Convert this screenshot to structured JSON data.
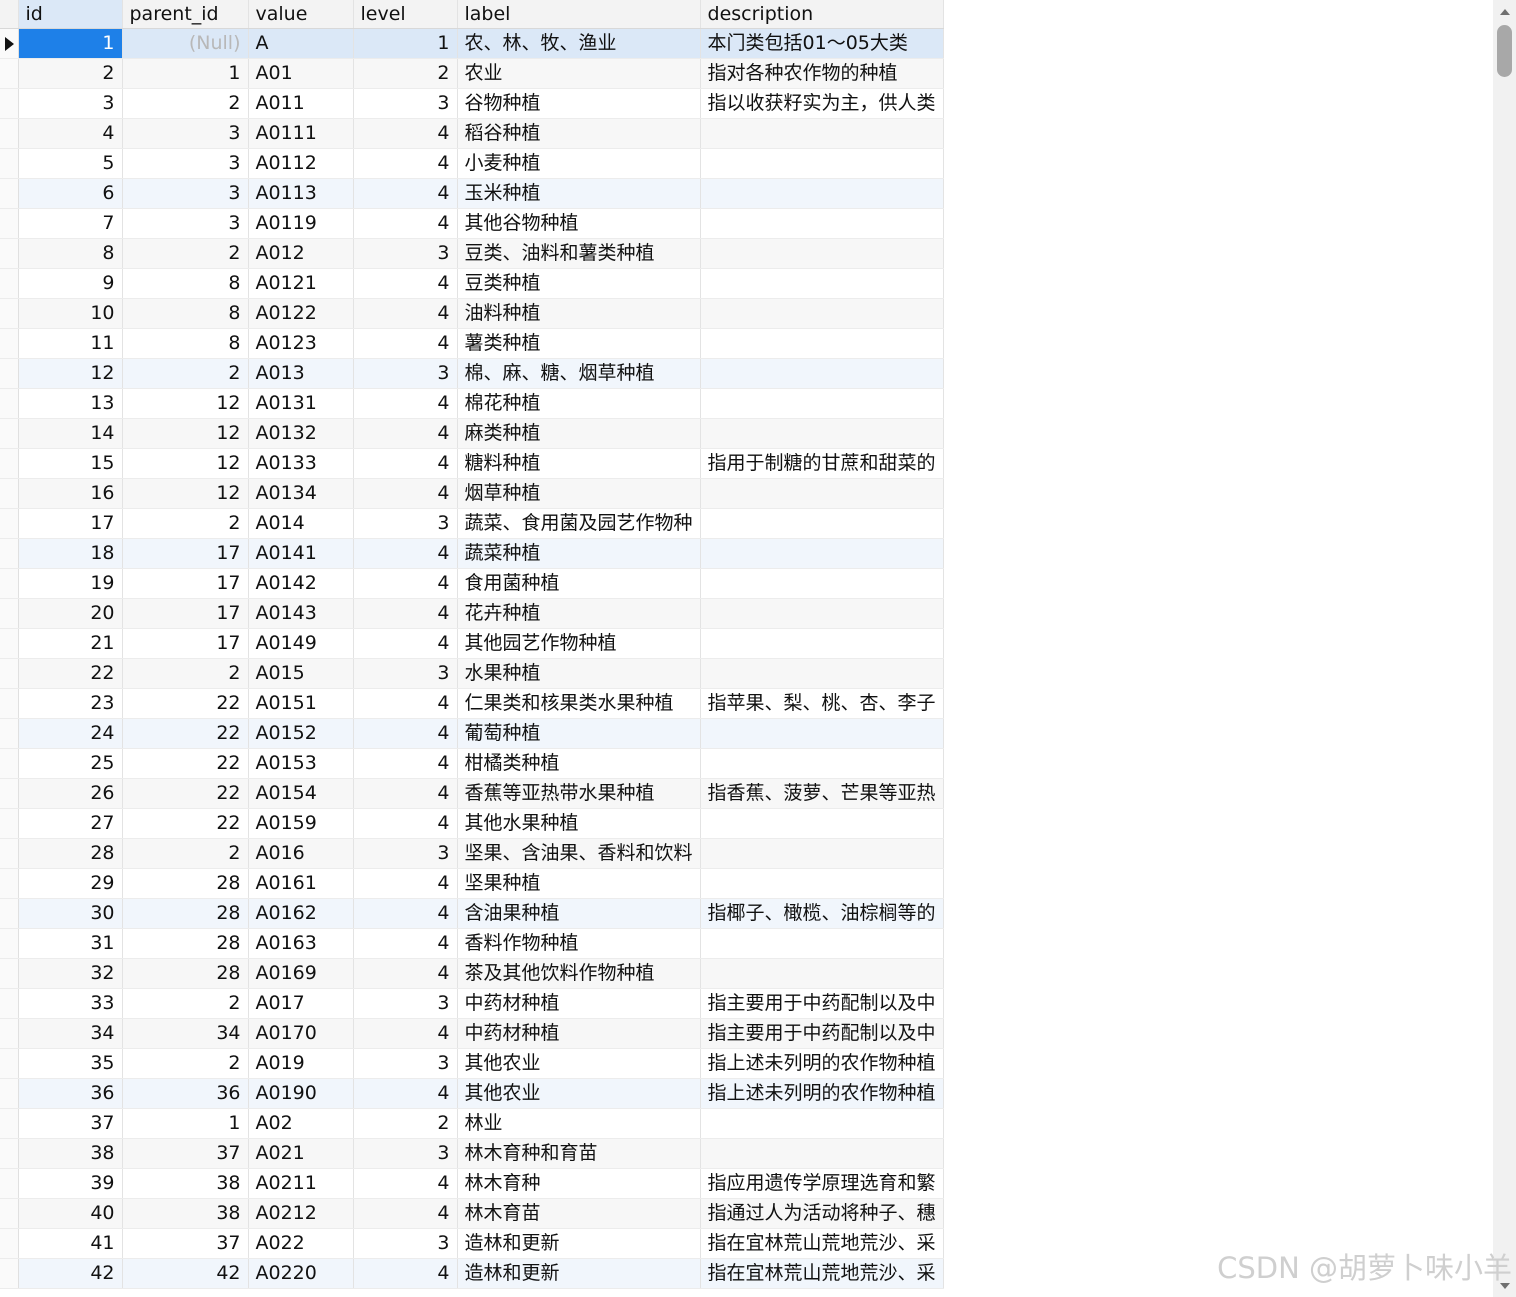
{
  "columns": [
    "id",
    "parent_id",
    "value",
    "level",
    "label",
    "description"
  ],
  "null_text": "(Null)",
  "watermark": "CSDN @胡萝卜味小羊",
  "rows": [
    {
      "id": "1",
      "parent_id": "(Null)",
      "value": "A",
      "level": "1",
      "label": "农、林、牧、渔业",
      "description": "本门类包括01～05大类"
    },
    {
      "id": "2",
      "parent_id": "1",
      "value": "A01",
      "level": "2",
      "label": "农业",
      "description": "指对各种农作物的种植"
    },
    {
      "id": "3",
      "parent_id": "2",
      "value": "A011",
      "level": "3",
      "label": "谷物种植",
      "description": "指以收获籽实为主，供人类"
    },
    {
      "id": "4",
      "parent_id": "3",
      "value": "A0111",
      "level": "4",
      "label": "稻谷种植",
      "description": ""
    },
    {
      "id": "5",
      "parent_id": "3",
      "value": "A0112",
      "level": "4",
      "label": "小麦种植",
      "description": ""
    },
    {
      "id": "6",
      "parent_id": "3",
      "value": "A0113",
      "level": "4",
      "label": "玉米种植",
      "description": ""
    },
    {
      "id": "7",
      "parent_id": "3",
      "value": "A0119",
      "level": "4",
      "label": "其他谷物种植",
      "description": ""
    },
    {
      "id": "8",
      "parent_id": "2",
      "value": "A012",
      "level": "3",
      "label": "豆类、油料和薯类种植",
      "description": ""
    },
    {
      "id": "9",
      "parent_id": "8",
      "value": "A0121",
      "level": "4",
      "label": "豆类种植",
      "description": ""
    },
    {
      "id": "10",
      "parent_id": "8",
      "value": "A0122",
      "level": "4",
      "label": "油料种植",
      "description": ""
    },
    {
      "id": "11",
      "parent_id": "8",
      "value": "A0123",
      "level": "4",
      "label": "薯类种植",
      "description": ""
    },
    {
      "id": "12",
      "parent_id": "2",
      "value": "A013",
      "level": "3",
      "label": "棉、麻、糖、烟草种植",
      "description": ""
    },
    {
      "id": "13",
      "parent_id": "12",
      "value": "A0131",
      "level": "4",
      "label": "棉花种植",
      "description": ""
    },
    {
      "id": "14",
      "parent_id": "12",
      "value": "A0132",
      "level": "4",
      "label": "麻类种植",
      "description": ""
    },
    {
      "id": "15",
      "parent_id": "12",
      "value": "A0133",
      "level": "4",
      "label": "糖料种植",
      "description": "指用于制糖的甘蔗和甜菜的"
    },
    {
      "id": "16",
      "parent_id": "12",
      "value": "A0134",
      "level": "4",
      "label": "烟草种植",
      "description": ""
    },
    {
      "id": "17",
      "parent_id": "2",
      "value": "A014",
      "level": "3",
      "label": "蔬菜、食用菌及园艺作物种",
      "description": ""
    },
    {
      "id": "18",
      "parent_id": "17",
      "value": "A0141",
      "level": "4",
      "label": "蔬菜种植",
      "description": ""
    },
    {
      "id": "19",
      "parent_id": "17",
      "value": "A0142",
      "level": "4",
      "label": "食用菌种植",
      "description": ""
    },
    {
      "id": "20",
      "parent_id": "17",
      "value": "A0143",
      "level": "4",
      "label": "花卉种植",
      "description": ""
    },
    {
      "id": "21",
      "parent_id": "17",
      "value": "A0149",
      "level": "4",
      "label": "其他园艺作物种植",
      "description": ""
    },
    {
      "id": "22",
      "parent_id": "2",
      "value": "A015",
      "level": "3",
      "label": "水果种植",
      "description": ""
    },
    {
      "id": "23",
      "parent_id": "22",
      "value": "A0151",
      "level": "4",
      "label": "仁果类和核果类水果种植",
      "description": "指苹果、梨、桃、杏、李子"
    },
    {
      "id": "24",
      "parent_id": "22",
      "value": "A0152",
      "level": "4",
      "label": "葡萄种植",
      "description": ""
    },
    {
      "id": "25",
      "parent_id": "22",
      "value": "A0153",
      "level": "4",
      "label": "柑橘类种植",
      "description": ""
    },
    {
      "id": "26",
      "parent_id": "22",
      "value": "A0154",
      "level": "4",
      "label": "香蕉等亚热带水果种植",
      "description": "指香蕉、菠萝、芒果等亚热"
    },
    {
      "id": "27",
      "parent_id": "22",
      "value": "A0159",
      "level": "4",
      "label": "其他水果种植",
      "description": ""
    },
    {
      "id": "28",
      "parent_id": "2",
      "value": "A016",
      "level": "3",
      "label": "坚果、含油果、香料和饮料",
      "description": ""
    },
    {
      "id": "29",
      "parent_id": "28",
      "value": "A0161",
      "level": "4",
      "label": "坚果种植",
      "description": ""
    },
    {
      "id": "30",
      "parent_id": "28",
      "value": "A0162",
      "level": "4",
      "label": "含油果种植",
      "description": "指椰子、橄榄、油棕榈等的"
    },
    {
      "id": "31",
      "parent_id": "28",
      "value": "A0163",
      "level": "4",
      "label": "香料作物种植",
      "description": ""
    },
    {
      "id": "32",
      "parent_id": "28",
      "value": "A0169",
      "level": "4",
      "label": "茶及其他饮料作物种植",
      "description": ""
    },
    {
      "id": "33",
      "parent_id": "2",
      "value": "A017",
      "level": "3",
      "label": "中药材种植",
      "description": "指主要用于中药配制以及中"
    },
    {
      "id": "34",
      "parent_id": "34",
      "value": "A0170",
      "level": "4",
      "label": "中药材种植",
      "description": "指主要用于中药配制以及中"
    },
    {
      "id": "35",
      "parent_id": "2",
      "value": "A019",
      "level": "3",
      "label": "其他农业",
      "description": "指上述未列明的农作物种植"
    },
    {
      "id": "36",
      "parent_id": "36",
      "value": "A0190",
      "level": "4",
      "label": "其他农业",
      "description": "指上述未列明的农作物种植"
    },
    {
      "id": "37",
      "parent_id": "1",
      "value": "A02",
      "level": "2",
      "label": "林业",
      "description": ""
    },
    {
      "id": "38",
      "parent_id": "37",
      "value": "A021",
      "level": "3",
      "label": "林木育种和育苗",
      "description": ""
    },
    {
      "id": "39",
      "parent_id": "38",
      "value": "A0211",
      "level": "4",
      "label": "林木育种",
      "description": "指应用遗传学原理选育和繁"
    },
    {
      "id": "40",
      "parent_id": "38",
      "value": "A0212",
      "level": "4",
      "label": "林木育苗",
      "description": "指通过人为活动将种子、穗"
    },
    {
      "id": "41",
      "parent_id": "37",
      "value": "A022",
      "level": "3",
      "label": "造林和更新",
      "description": "指在宜林荒山荒地荒沙、采"
    },
    {
      "id": "42",
      "parent_id": "42",
      "value": "A0220",
      "level": "4",
      "label": "造林和更新",
      "description": "指在宜林荒山荒地荒沙、采"
    }
  ]
}
